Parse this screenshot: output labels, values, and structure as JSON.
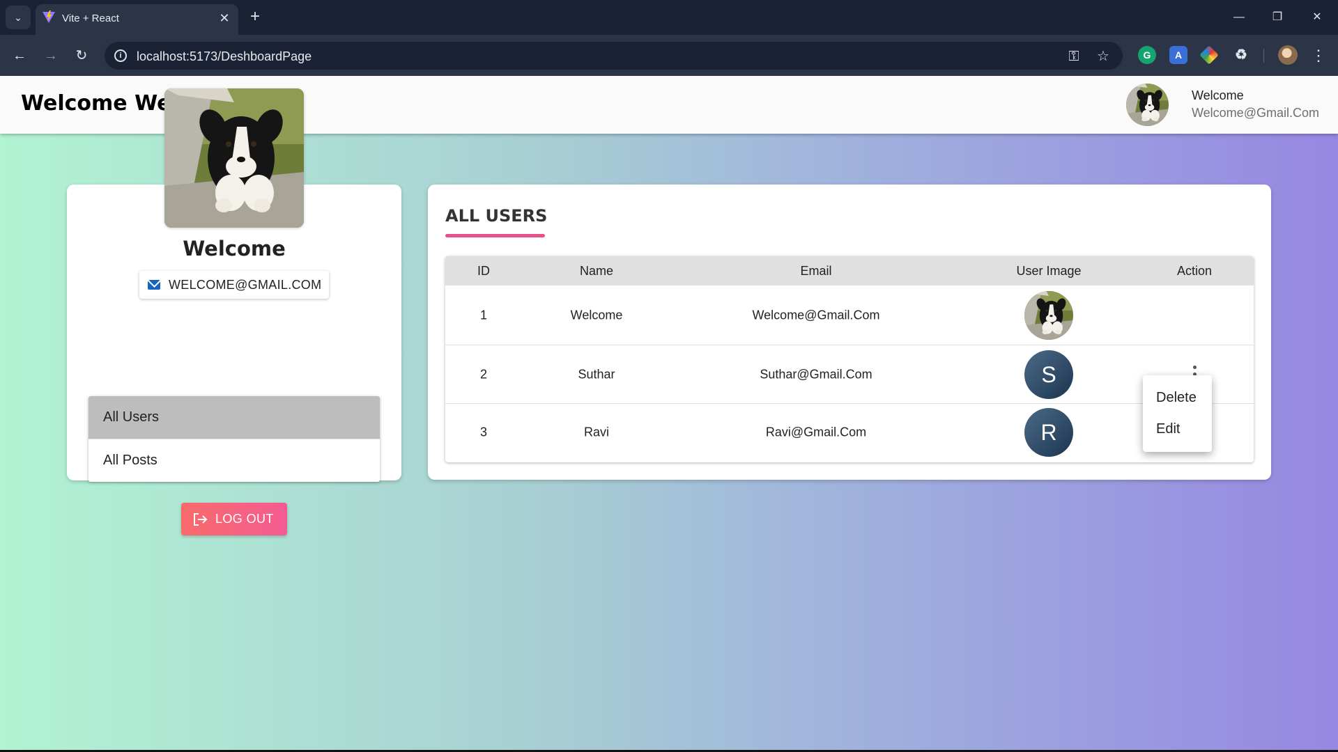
{
  "browser": {
    "tab_title": "Vite + React",
    "url": "localhost:5173/DeshboardPage"
  },
  "header": {
    "brand": "Welcome Welcome",
    "user_name": "Welcome",
    "user_email": "Welcome@Gmail.Com"
  },
  "profile": {
    "name": "Welcome",
    "email": "WELCOME@GMAIL.COM",
    "menu": [
      {
        "label": "All Users",
        "active": true
      },
      {
        "label": "All Posts",
        "active": false
      }
    ],
    "logout_label": "LOG OUT"
  },
  "users": {
    "title": "ALL USERS",
    "columns": [
      "ID",
      "Name",
      "Email",
      "User Image",
      "Action"
    ],
    "rows": [
      {
        "id": "1",
        "name": "Welcome",
        "email": "Welcome@Gmail.Com",
        "image": "photo"
      },
      {
        "id": "2",
        "name": "Suthar",
        "email": "Suthar@Gmail.Com",
        "initial": "S"
      },
      {
        "id": "3",
        "name": "Ravi",
        "email": "Ravi@Gmail.Com",
        "initial": "R"
      }
    ],
    "action_menu": [
      "Delete",
      "Edit"
    ]
  },
  "icons": {
    "mail": "mail-icon",
    "logout": "logout-icon",
    "more": "more-vert-icon"
  },
  "colors": {
    "accent_underline": "#e8508a",
    "logout_start": "#f86b6b",
    "logout_end": "#f45b92",
    "bg_left": "#b1f3d3",
    "bg_right": "#9787e2"
  }
}
